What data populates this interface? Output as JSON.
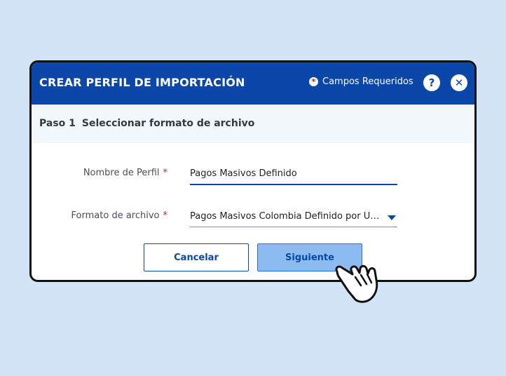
{
  "dialog": {
    "title": "CREAR PERFIL DE IMPORTACIÓN",
    "required_label": "Campos Requeridos",
    "required_marker": "*",
    "help_label": "?",
    "close_label": "✕"
  },
  "step": {
    "number": "Paso 1",
    "title": "Seleccionar formato de archivo"
  },
  "form": {
    "profile_name_label": "Nombre de Perfil",
    "profile_name_value": "Pagos Masivos Definido",
    "file_format_label": "Formato de archivo",
    "file_format_value": "Pagos Masivos Colombia Definido por Usuario",
    "required_marker": "*"
  },
  "buttons": {
    "cancel_label": "Cancelar",
    "next_label": "Siguiente"
  },
  "colors": {
    "background": "#d3e4f6",
    "header": "#0a47a8",
    "required_marker": "#d3202f",
    "primary_button": "#8cbcef"
  },
  "icons": {
    "help": "question-icon",
    "close": "close-icon",
    "select": "chevron-down-icon",
    "cursor": "hand-pointer-icon"
  }
}
